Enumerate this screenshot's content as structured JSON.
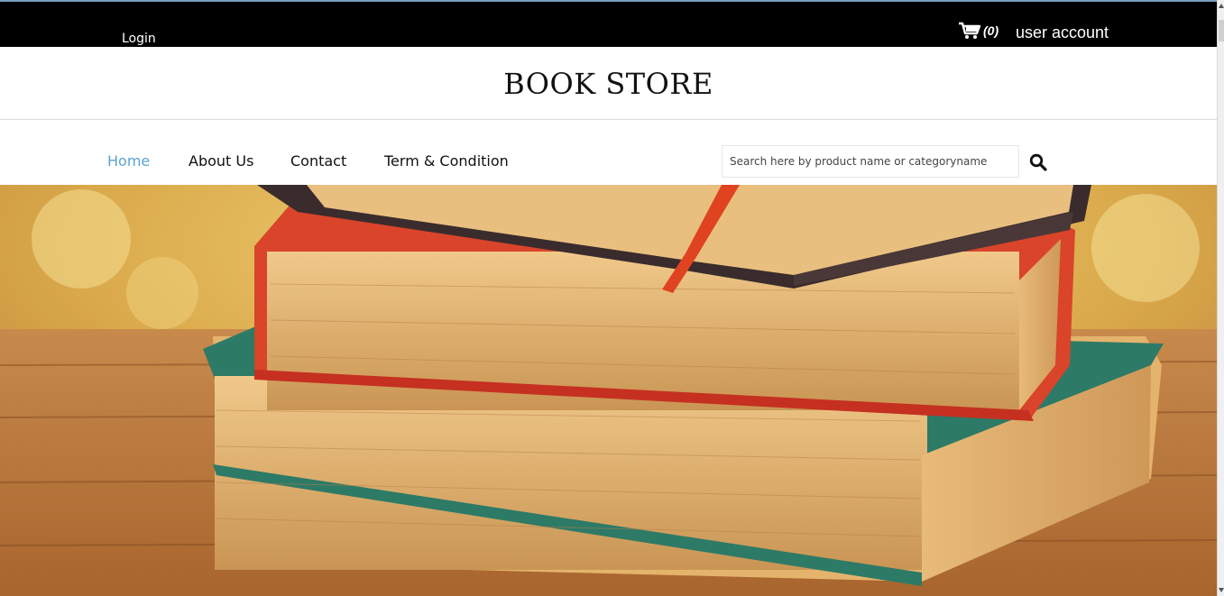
{
  "topbar": {
    "login_label": "Login",
    "cart_count": "(0)",
    "account_label": "user account"
  },
  "header": {
    "title": "BOOK STORE"
  },
  "nav": {
    "items": [
      {
        "label": "Home",
        "active": true
      },
      {
        "label": "About Us",
        "active": false
      },
      {
        "label": "Contact",
        "active": false
      },
      {
        "label": "Term & Condition",
        "active": false
      }
    ]
  },
  "search": {
    "placeholder": "Search here by product name or categoryname",
    "value": ""
  },
  "hero": {
    "icon": "stack-of-books-image"
  },
  "colors": {
    "topbar": "#000000",
    "active_nav": "#5ba3cf",
    "text": "#111111"
  }
}
